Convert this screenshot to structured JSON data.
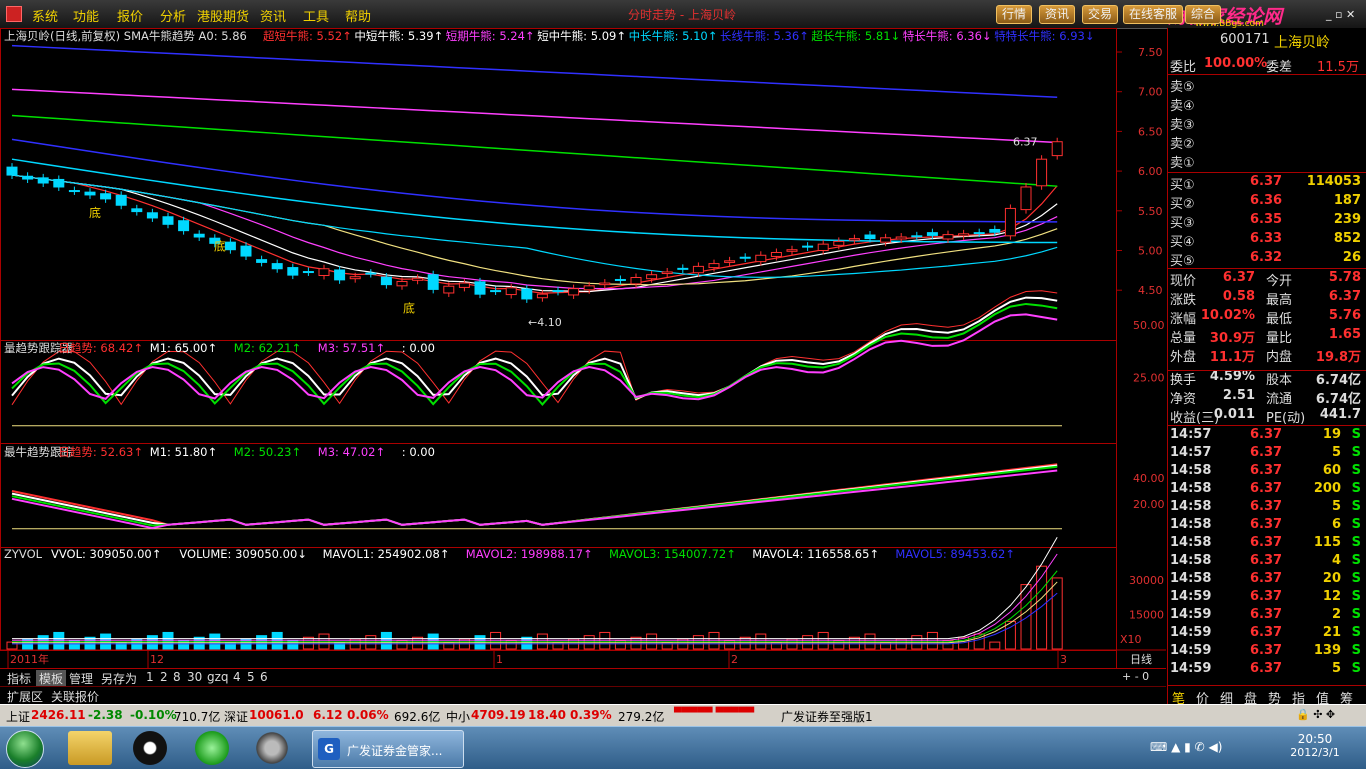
{
  "menu": {
    "items": [
      "系统",
      "功能",
      "报价",
      "分析",
      "港股期货",
      "资讯",
      "工具",
      "帮助"
    ],
    "title": "分时走势 - 上海贝岭",
    "buttons": [
      "行情",
      "资讯",
      "交易",
      "在线客服",
      "综合"
    ],
    "watermark": "财析家经论网",
    "watermark_url": "www.BBgs.com"
  },
  "colors": {
    "red": "#ff3030",
    "green": "#00e000",
    "yellow": "#f0d000",
    "cyan": "#00d8ff",
    "magenta": "#ff40ff",
    "white": "#ffffff",
    "blue": "#3030ff"
  },
  "main_panel": {
    "title": "上海贝岭(日线,前复权) SMA牛熊趋势 A0: 5.86",
    "params": [
      {
        "text": "超短牛熊: 5.52↑",
        "color": "#ff3030"
      },
      {
        "text": "中短牛熊: 5.39↑",
        "color": "#ffffff"
      },
      {
        "text": "短期牛熊: 5.24↑",
        "color": "#ff40ff"
      },
      {
        "text": "短中牛熊: 5.09↑",
        "color": "#ffffff"
      },
      {
        "text": "中长牛熊: 5.10↑",
        "color": "#00d8ff"
      },
      {
        "text": "长线牛熊: 5.36↑",
        "color": "#3030ff"
      },
      {
        "text": "超长牛熊: 5.81↓",
        "color": "#00e000"
      },
      {
        "text": "特长牛熊: 6.36↓",
        "color": "#ff40ff"
      },
      {
        "text": "特特长牛熊: 6.93↓",
        "color": "#3030ff"
      }
    ],
    "axis_labels": [
      "7.50",
      "7.00",
      "6.50",
      "6.00",
      "5.50",
      "5.00",
      "4.50"
    ],
    "price_label": "6.37",
    "marker_bottom": "底",
    "marker_low": "←4.10"
  },
  "panel2": {
    "params": [
      {
        "text": "量趋势跟踪器",
        "color": "#dddddd"
      },
      {
        "text": "日趋势: 68.42↑",
        "color": "#ff3030"
      },
      {
        "text": "M1: 65.00↑",
        "color": "#ffffff"
      },
      {
        "text": "M2: 62.21↑",
        "color": "#00e000"
      },
      {
        "text": "M3: 57.51↑",
        "color": "#ff40ff"
      },
      {
        "text": ": 0.00",
        "color": "#ffffff"
      }
    ],
    "axis_labels": [
      "50.00",
      "25.00"
    ]
  },
  "panel3": {
    "params": [
      {
        "text": "最牛趋势跟踪",
        "color": "#dddddd"
      },
      {
        "text": "日趋势: 52.63↑",
        "color": "#ff3030"
      },
      {
        "text": "M1: 51.80↑",
        "color": "#ffffff"
      },
      {
        "text": "M2: 50.23↑",
        "color": "#00e000"
      },
      {
        "text": "M3: 47.02↑",
        "color": "#ff40ff"
      },
      {
        "text": ": 0.00",
        "color": "#ffffff"
      }
    ],
    "axis_labels": [
      "40.00",
      "20.00"
    ]
  },
  "panel4": {
    "params": [
      {
        "text": "ZYVOL",
        "color": "#dddddd"
      },
      {
        "text": "VVOL: 309050.00↑",
        "color": "#ffffff"
      },
      {
        "text": "VOLUME: 309050.00↓",
        "color": "#ffffff"
      },
      {
        "text": "MAVOL1: 254902.08↑",
        "color": "#ffffff"
      },
      {
        "text": "MAVOL2: 198988.17↑",
        "color": "#ff40ff"
      },
      {
        "text": "MAVOL3: 154007.72↑",
        "color": "#00e000"
      },
      {
        "text": "MAVOL4: 116558.65↑",
        "color": "#ffffff"
      },
      {
        "text": "MAVOL5: 89453.62↑",
        "color": "#3030ff"
      }
    ],
    "axis_labels": [
      "30000",
      "15000"
    ],
    "unit": "X10"
  },
  "date_axis": {
    "labels": [
      "2011年",
      "12",
      "1",
      "2",
      "3"
    ],
    "period": "日线"
  },
  "tabs": {
    "items": [
      "指标",
      "模板",
      "管理",
      "另存为",
      "1",
      "2",
      "8",
      "30",
      "gzq",
      "4",
      "5",
      "6"
    ],
    "ext": "扩展区",
    "ext2": "关联报价"
  },
  "quote": {
    "code": "600171",
    "name": "上海贝岭",
    "weibi_label": "委比",
    "weibi": "100.00%",
    "weicha_label": "委差",
    "weicha": "11.5万",
    "sells": [
      {
        "label": "卖⑤",
        "price": "",
        "vol": ""
      },
      {
        "label": "卖④",
        "price": "",
        "vol": ""
      },
      {
        "label": "卖③",
        "price": "",
        "vol": ""
      },
      {
        "label": "卖②",
        "price": "",
        "vol": ""
      },
      {
        "label": "卖①",
        "price": "",
        "vol": ""
      }
    ],
    "buys": [
      {
        "label": "买①",
        "price": "6.37",
        "vol": "114053"
      },
      {
        "label": "买②",
        "price": "6.36",
        "vol": "187"
      },
      {
        "label": "买③",
        "price": "6.35",
        "vol": "239"
      },
      {
        "label": "买④",
        "price": "6.33",
        "vol": "852"
      },
      {
        "label": "买⑤",
        "price": "6.32",
        "vol": "26"
      }
    ],
    "stats": [
      [
        "现价",
        "6.37",
        "今开",
        "5.78"
      ],
      [
        "涨跌",
        "0.58",
        "最高",
        "6.37"
      ],
      [
        "涨幅",
        "10.02%",
        "最低",
        "5.76"
      ],
      [
        "总量",
        "30.9万",
        "量比",
        "1.65"
      ],
      [
        "外盘",
        "11.1万",
        "内盘",
        "19.8万"
      ],
      [
        "换手",
        "4.59%",
        "股本",
        "6.74亿"
      ],
      [
        "净资",
        "2.51",
        "流通",
        "6.74亿"
      ],
      [
        "收益(三)",
        "0.011",
        "PE(动)",
        "441.7"
      ]
    ],
    "ticks": [
      [
        "14:57",
        "6.37",
        "19",
        "S"
      ],
      [
        "14:57",
        "6.37",
        "5",
        "S"
      ],
      [
        "14:58",
        "6.37",
        "60",
        "S"
      ],
      [
        "14:58",
        "6.37",
        "200",
        "S"
      ],
      [
        "14:58",
        "6.37",
        "5",
        "S"
      ],
      [
        "14:58",
        "6.37",
        "6",
        "S"
      ],
      [
        "14:58",
        "6.37",
        "115",
        "S"
      ],
      [
        "14:58",
        "6.37",
        "4",
        "S"
      ],
      [
        "14:58",
        "6.37",
        "20",
        "S"
      ],
      [
        "14:59",
        "6.37",
        "12",
        "S"
      ],
      [
        "14:59",
        "6.37",
        "2",
        "S"
      ],
      [
        "14:59",
        "6.37",
        "21",
        "S"
      ],
      [
        "14:59",
        "6.37",
        "139",
        "S"
      ],
      [
        "14:59",
        "6.37",
        "5",
        "S"
      ]
    ],
    "bottom_tabs": [
      "笔",
      "价",
      "细",
      "盘",
      "势",
      "指",
      "值",
      "筹"
    ]
  },
  "statusbar": {
    "sh_label": "上证",
    "sh_value": "2426.11",
    "sh_chg": "-2.38",
    "sh_pct": "-0.10%",
    "sh_amt": "710.7亿",
    "sz_label": "深证",
    "sz_value": "10061.0",
    "sz_chg": "6.12",
    "sz_pct": "0.06%",
    "sz_amt": "692.6亿",
    "zx_label": "中小",
    "zx_value": "4709.19",
    "zx_chg": "18.40",
    "zx_pct": "0.39%",
    "zx_amt": "279.2亿",
    "broker": "广发证券至强版1"
  },
  "taskbar": {
    "task": "广发证券金管家...",
    "time": "20:50",
    "date": "2012/3/1"
  }
}
